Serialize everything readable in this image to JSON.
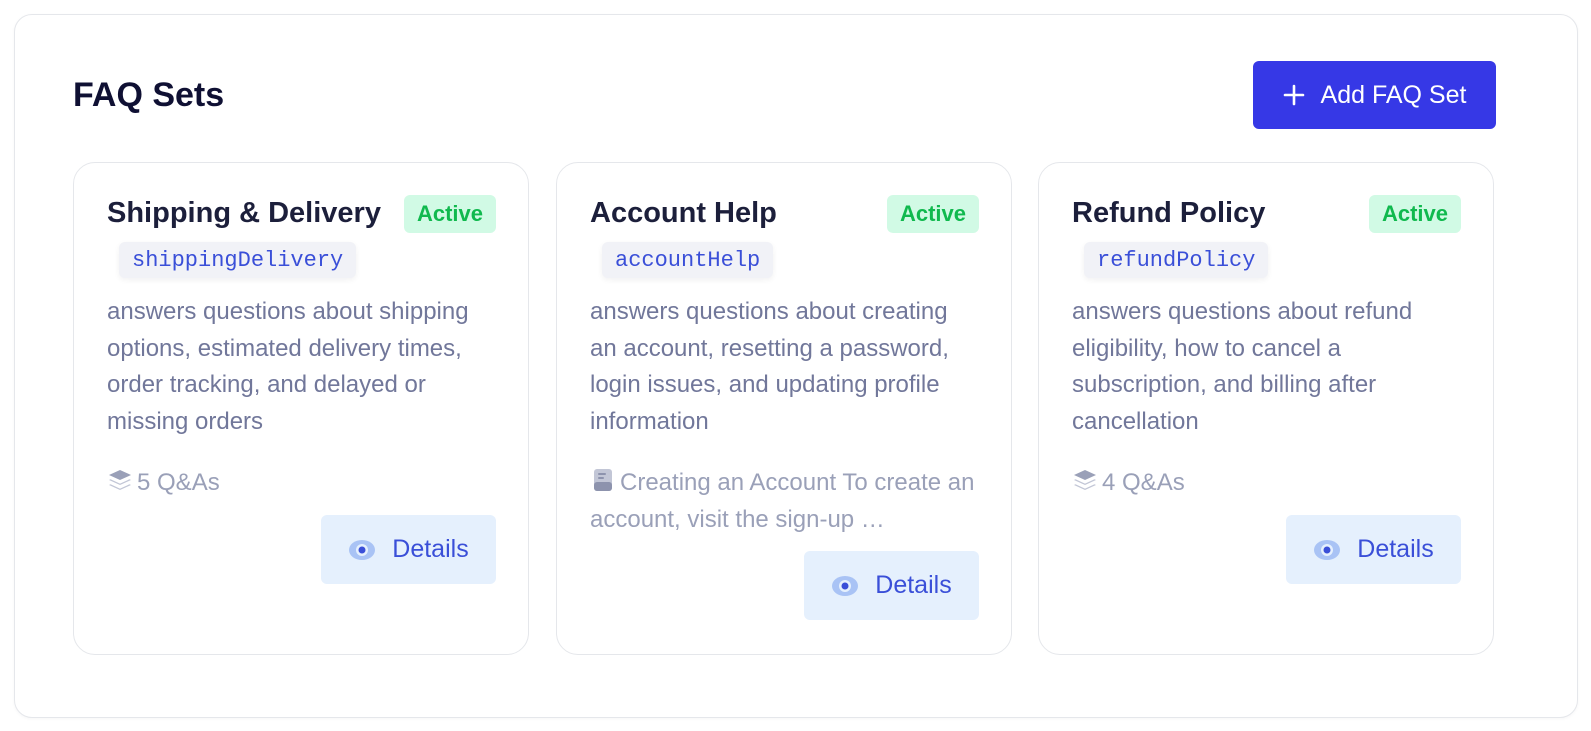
{
  "panel": {
    "title": "FAQ Sets",
    "add_button_label": "Add FAQ Set"
  },
  "cards": [
    {
      "title": "Shipping & Delivery",
      "status": "Active",
      "code": "shippingDelivery",
      "description": "answers questions about shipping options, estimated delivery times, order tracking, and delayed or missing orders",
      "meta_icon": "stack-icon",
      "meta_text": "5 Q&As",
      "details_label": "Details"
    },
    {
      "title": "Account Help",
      "status": "Active",
      "code": "accountHelp",
      "description": "answers questions about creating an account, resetting a password, login issues, and updating profile information",
      "meta_icon": "document-icon",
      "meta_text": "Creating an Account To create an account, visit the sign-up …",
      "details_label": "Details"
    },
    {
      "title": "Refund Policy",
      "status": "Active",
      "code": "refundPolicy",
      "description": "answers questions about refund eligibility, how to cancel a subscription, and billing after cancellation",
      "meta_icon": "stack-icon",
      "meta_text": "4 Q&As",
      "details_label": "Details"
    }
  ],
  "colors": {
    "accent": "#3638e6",
    "badge_bg": "#d1fae5",
    "badge_text": "#10b94e",
    "details_bg": "#e5f0fd",
    "details_text": "#3a4fd8"
  }
}
